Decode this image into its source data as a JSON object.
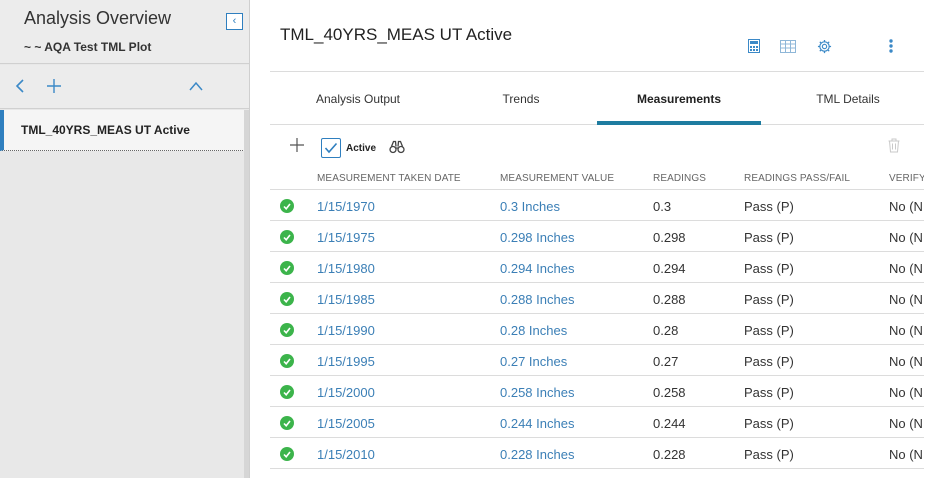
{
  "sidebar": {
    "title": "Analysis Overview",
    "subtitle": "~ ~ AQA Test TML Plot",
    "items": [
      {
        "label": "TML_40YRS_MEAS UT Active"
      }
    ]
  },
  "main": {
    "title": "TML_40YRS_MEAS UT Active",
    "tabs": [
      {
        "label": "Analysis Output"
      },
      {
        "label": "Trends"
      },
      {
        "label": "Measurements",
        "active": true
      },
      {
        "label": "TML Details"
      }
    ],
    "toolbar": {
      "active_label": "Active"
    },
    "grid": {
      "columns": [
        "MEASUREMENT TAKEN DATE",
        "MEASUREMENT VALUE",
        "READINGS",
        "READINGS PASS/FAIL",
        "VERIFY"
      ],
      "rows": [
        {
          "date": "1/15/1970",
          "value": "0.3 Inches",
          "readings": "0.3",
          "pass": "Pass (P)",
          "verify": "No (N"
        },
        {
          "date": "1/15/1975",
          "value": "0.298 Inches",
          "readings": "0.298",
          "pass": "Pass (P)",
          "verify": "No (N"
        },
        {
          "date": "1/15/1980",
          "value": "0.294 Inches",
          "readings": "0.294",
          "pass": "Pass (P)",
          "verify": "No (N"
        },
        {
          "date": "1/15/1985",
          "value": "0.288 Inches",
          "readings": "0.288",
          "pass": "Pass (P)",
          "verify": "No (N"
        },
        {
          "date": "1/15/1990",
          "value": "0.28 Inches",
          "readings": "0.28",
          "pass": "Pass (P)",
          "verify": "No (N"
        },
        {
          "date": "1/15/1995",
          "value": "0.27 Inches",
          "readings": "0.27",
          "pass": "Pass (P)",
          "verify": "No (N"
        },
        {
          "date": "1/15/2000",
          "value": "0.258 Inches",
          "readings": "0.258",
          "pass": "Pass (P)",
          "verify": "No (N"
        },
        {
          "date": "1/15/2005",
          "value": "0.244 Inches",
          "readings": "0.244",
          "pass": "Pass (P)",
          "verify": "No (N"
        },
        {
          "date": "1/15/2010",
          "value": "0.228 Inches",
          "readings": "0.228",
          "pass": "Pass (P)",
          "verify": "No (N"
        }
      ]
    }
  },
  "colors": {
    "accent": "#1e7ca0",
    "link": "#3b7fb6",
    "status_ok": "#3cb44b"
  },
  "icons": {
    "sidebar_collapse": "chevron-left-icon",
    "sidebar_back": "chevron-left-icon",
    "sidebar_add": "plus-icon",
    "sidebar_collapse_up": "chevron-up-icon",
    "header": [
      "calculator-icon",
      "table-icon",
      "gear-icon",
      "kebab-menu-icon"
    ],
    "toolbar": [
      "plus-icon",
      "checkbox-checked-icon",
      "binoculars-icon",
      "trash-icon"
    ],
    "row_status": "check-circle-icon"
  }
}
